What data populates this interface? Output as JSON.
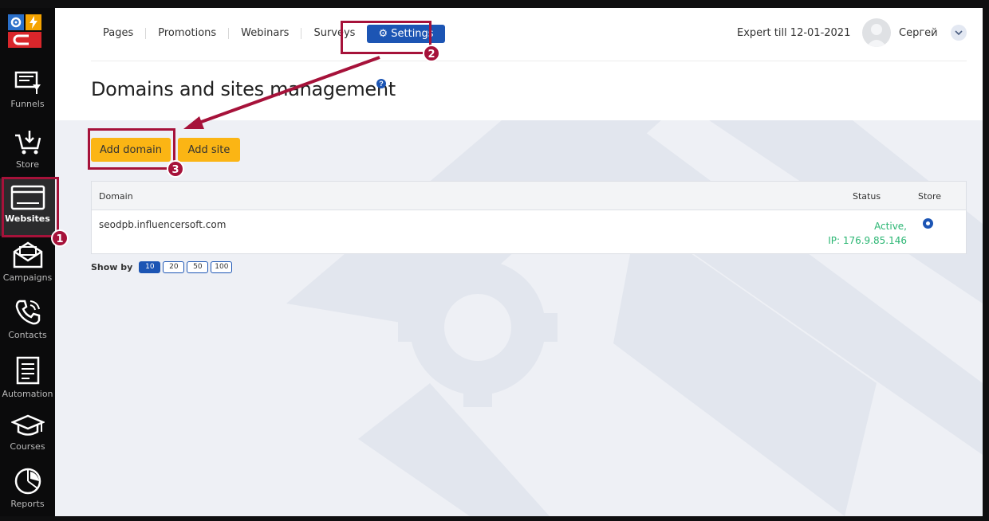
{
  "sidebar": {
    "items": [
      {
        "label": "Funnels",
        "icon": "funnel-monitor-icon"
      },
      {
        "label": "Store",
        "icon": "cart-icon"
      },
      {
        "label": "Websites",
        "icon": "browser-window-icon",
        "active": true
      },
      {
        "label": "Campaigns",
        "icon": "envelope-icon"
      },
      {
        "label": "Contacts",
        "icon": "phone-icon"
      },
      {
        "label": "Automation",
        "icon": "document-icon"
      },
      {
        "label": "Courses",
        "icon": "graduation-cap-icon"
      },
      {
        "label": "Reports",
        "icon": "pie-chart-icon"
      }
    ]
  },
  "nav": {
    "items": [
      "Pages",
      "Promotions",
      "Webinars",
      "Surveys"
    ],
    "settings_label": "Settings"
  },
  "account": {
    "plan": "Expert till 12-01-2021",
    "user_name": "Сергей"
  },
  "page": {
    "title": "Domains and sites management",
    "help": "?"
  },
  "actions": {
    "add_domain": "Add domain",
    "add_site": "Add site"
  },
  "table": {
    "headers": {
      "domain": "Domain",
      "status": "Status",
      "store": "Store"
    },
    "rows": [
      {
        "domain": "seodpb.influencersoft.com",
        "status_line1": "Active,",
        "status_line2": "IP: 176.9.85.146",
        "store_selected": true
      }
    ]
  },
  "pagination": {
    "label": "Show by",
    "options": [
      "10",
      "20",
      "50",
      "100"
    ],
    "selected": "10"
  },
  "annotations": [
    "1",
    "2",
    "3"
  ],
  "colors": {
    "accent_blue": "#1c55b4",
    "button_yellow": "#fbb514",
    "annotation_red": "#a6123a",
    "status_green": "#2bb673"
  }
}
